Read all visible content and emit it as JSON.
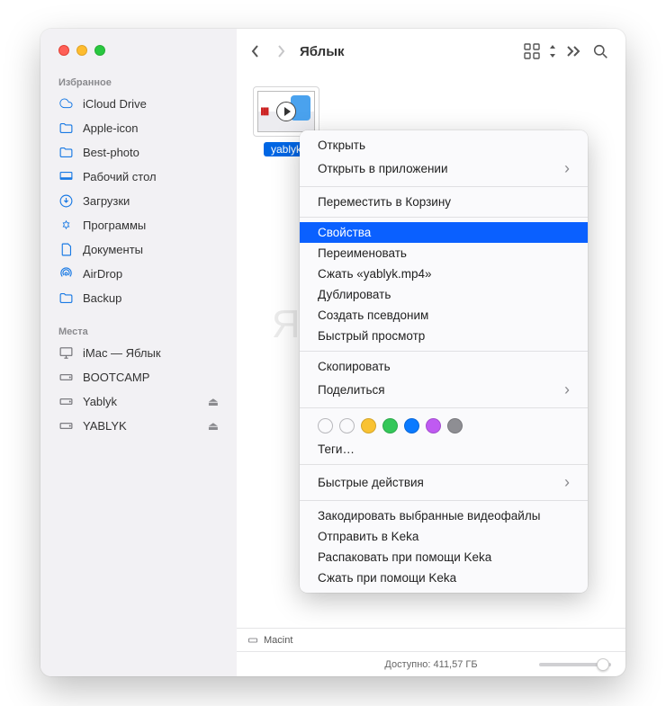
{
  "sidebar": {
    "favorites_label": "Избранное",
    "locations_label": "Места",
    "favorites": [
      {
        "icon": "cloud",
        "label": "iCloud Drive"
      },
      {
        "icon": "folder",
        "label": "Apple-icon"
      },
      {
        "icon": "folder",
        "label": "Best-photo"
      },
      {
        "icon": "desktop",
        "label": "Рабочий стол"
      },
      {
        "icon": "download",
        "label": "Загрузки"
      },
      {
        "icon": "apps",
        "label": "Программы"
      },
      {
        "icon": "doc",
        "label": "Документы"
      },
      {
        "icon": "airdrop",
        "label": "AirDrop"
      },
      {
        "icon": "folder",
        "label": "Backup"
      }
    ],
    "locations": [
      {
        "icon": "imac",
        "label": "iMac — Яблык",
        "eject": false
      },
      {
        "icon": "disk",
        "label": "BOOTCAMP",
        "eject": false
      },
      {
        "icon": "disk",
        "label": "Yablyk",
        "eject": true
      },
      {
        "icon": "disk",
        "label": "YABLYK",
        "eject": true
      }
    ]
  },
  "toolbar": {
    "title": "Яблык"
  },
  "file": {
    "label": "yablyk"
  },
  "watermark": "Яблык",
  "pathbar": {
    "root": "Macint"
  },
  "statusbar": {
    "available": "Доступно: 411,57 ГБ"
  },
  "menu": {
    "open": "Открыть",
    "open_with": "Открыть в приложении",
    "trash": "Переместить в Корзину",
    "info": "Свойства",
    "rename": "Переименовать",
    "compress": "Сжать «yablyk.mp4»",
    "duplicate": "Дублировать",
    "alias": "Создать псевдоним",
    "quicklook": "Быстрый просмотр",
    "copy": "Скопировать",
    "share": "Поделиться",
    "tags": "Теги…",
    "quick_actions": "Быстрые действия",
    "encode": "Закодировать выбранные видеофайлы",
    "send_keka": "Отправить в Keka",
    "extract_keka": "Распаковать при помощи Keka",
    "compress_keka": "Сжать при помощи Keka"
  },
  "tag_colors": [
    "",
    "",
    "#f9c232",
    "#34c759",
    "#0a7aff",
    "#bf5af2",
    "#8e8e93"
  ]
}
